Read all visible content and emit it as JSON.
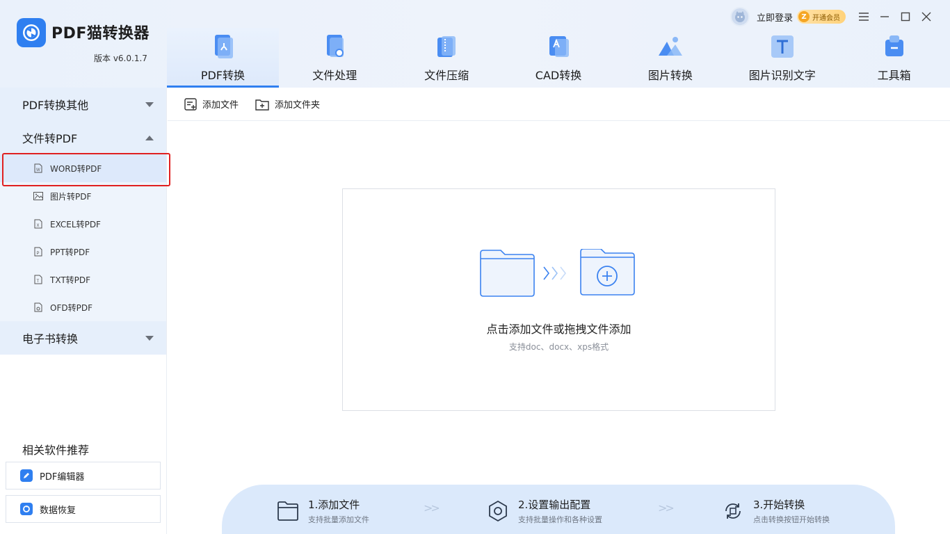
{
  "app": {
    "title": "PDF猫转换器",
    "version": "版本 v6.0.1.7"
  },
  "topbar": {
    "login": "立即登录",
    "vip_letter": "Z",
    "vip": "开通会员"
  },
  "nav": [
    {
      "label": "PDF转换",
      "icon": "pdf-convert-icon"
    },
    {
      "label": "文件处理",
      "icon": "file-process-icon"
    },
    {
      "label": "文件压缩",
      "icon": "file-compress-icon"
    },
    {
      "label": "CAD转换",
      "icon": "cad-convert-icon"
    },
    {
      "label": "图片转换",
      "icon": "image-convert-icon"
    },
    {
      "label": "图片识别文字",
      "icon": "ocr-text-icon"
    },
    {
      "label": "工具箱",
      "icon": "toolbox-icon"
    }
  ],
  "sidebar": {
    "groups": [
      {
        "label": "PDF转换其他"
      },
      {
        "label": "文件转PDF"
      },
      {
        "label": "电子书转换"
      }
    ],
    "items": [
      {
        "label": "WORD转PDF",
        "icon": "word-file-icon",
        "badge": "W"
      },
      {
        "label": "图片转PDF",
        "icon": "image-file-icon",
        "badge": ""
      },
      {
        "label": "EXCEL转PDF",
        "icon": "excel-file-icon",
        "badge": "X"
      },
      {
        "label": "PPT转PDF",
        "icon": "ppt-file-icon",
        "badge": "P"
      },
      {
        "label": "TXT转PDF",
        "icon": "txt-file-icon",
        "badge": "T"
      },
      {
        "label": "OFD转PDF",
        "icon": "ofd-file-icon",
        "badge": ""
      }
    ],
    "recommend_title": "相关软件推荐",
    "recommend": [
      {
        "label": "PDF编辑器"
      },
      {
        "label": "数据恢复"
      }
    ]
  },
  "toolbar": {
    "add_file": "添加文件",
    "add_folder": "添加文件夹"
  },
  "dropzone": {
    "main": "点击添加文件或拖拽文件添加",
    "sub": "支持doc、docx、xps格式"
  },
  "steps": [
    {
      "title": "1.添加文件",
      "desc": "支持批量添加文件"
    },
    {
      "title": "2.设置输出配置",
      "desc": "支持批量操作和各种设置"
    },
    {
      "title": "3.开始转换",
      "desc": "点击转换按钮开始转换"
    }
  ],
  "colors": {
    "accent": "#2f7ff0",
    "highlight": "#e02020",
    "panel": "#e6effb"
  }
}
